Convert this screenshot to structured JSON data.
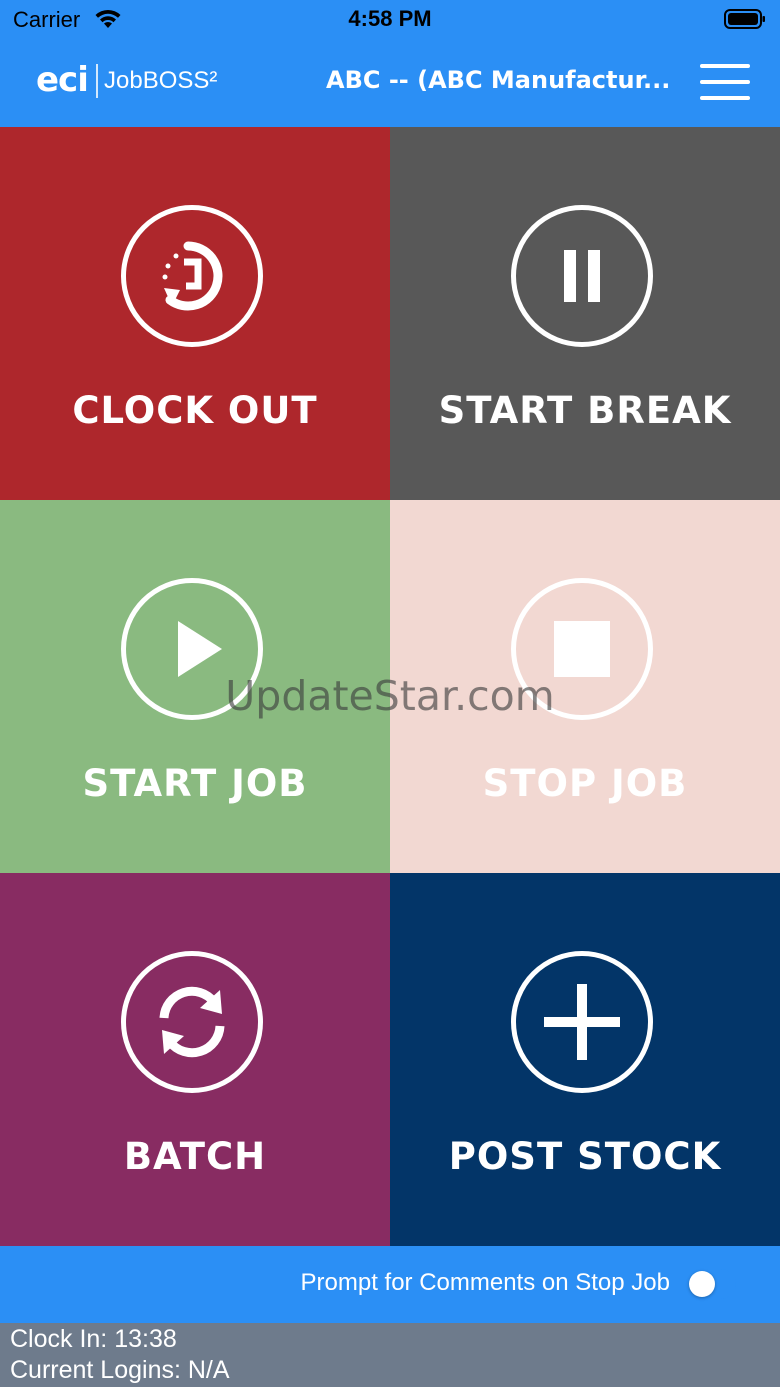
{
  "status_bar": {
    "carrier": "Carrier",
    "time": "4:58 PM"
  },
  "navbar": {
    "logo_eci": "eci",
    "logo_product": "JobBOSS²",
    "title": "ABC -- (ABC Manufactur..."
  },
  "tiles": [
    {
      "label": "CLOCK OUT",
      "icon": "clock-out-icon",
      "color": "#ae272c"
    },
    {
      "label": "START BREAK",
      "icon": "pause-icon",
      "color": "#585858"
    },
    {
      "label": "START JOB",
      "icon": "play-icon",
      "color": "#8aba80"
    },
    {
      "label": "STOP JOB",
      "icon": "stop-icon",
      "color": "#f2d8d2",
      "disabled": true
    },
    {
      "label": "BATCH",
      "icon": "refresh-icon",
      "color": "#882c62"
    },
    {
      "label": "POST STOCK",
      "icon": "plus-icon",
      "color": "#033568"
    }
  ],
  "watermark": "UpdateStar.com",
  "prompt": {
    "label": "Prompt for Comments on Stop Job",
    "enabled": false
  },
  "footer": {
    "clock_in": "Clock In: 13:38",
    "current_logins": "Current Logins: N/A"
  },
  "colors": {
    "accent": "#2b8ff5",
    "footer_bg": "#6e7b8c"
  }
}
